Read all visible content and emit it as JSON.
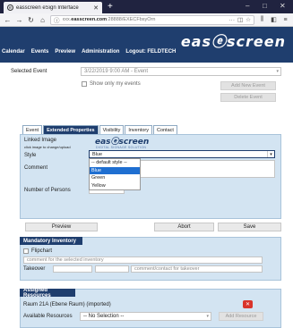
{
  "browser": {
    "tab_title": "easscreen eSign Interface",
    "url_prefix": "xxx.",
    "url_domain": "easscreen.com",
    "url_rest": ":28888/EXECFbsyOrn",
    "url_menu": "···"
  },
  "app": {
    "logo": "easⓔscreen",
    "menu": [
      "Calendar",
      "Events",
      "Preview",
      "Administration",
      "Logout: FELDTECH"
    ]
  },
  "event_select": {
    "label": "Selected Event",
    "value": "3/22/2019 9:00 AM - Event",
    "only_mine_label": "Show only my events",
    "add_btn": "Add New Event",
    "delete_btn": "Delete Event"
  },
  "tabs": [
    "Event",
    "Extended Properties",
    "Visibility",
    "Inventory",
    "Contact"
  ],
  "active_tab": "Extended Properties",
  "props": {
    "linked_image_label": "Linked Image",
    "linked_image_hint": "click image to change/upload",
    "mini_logo": "easⓔscreen",
    "mini_logo_sub": "DIGITAL SIGNAGE SOLUTION",
    "style_label": "Style",
    "style_value": "Blue",
    "style_options": [
      "-- default style --",
      "Blue",
      "Green",
      "Yellow"
    ],
    "comment_label": "Comment",
    "persons_label": "Number of Persons"
  },
  "actions": {
    "preview": "Preview",
    "abort": "Abort",
    "save": "Save"
  },
  "mandatory": {
    "header": "Mandatory Inventory",
    "item": "Flipchart",
    "comment_placeholder": "comment for the selected inventory",
    "takeover_label": "Takeover",
    "takeover_placeholder": "comment/contact for takeover"
  },
  "resources": {
    "header": "Assigned Resources",
    "assigned": "Raum 21A (Ebene Raum) (imported)",
    "available_label": "Available Resources",
    "available_value": "-- No Selection --",
    "add_btn": "Add Resource"
  },
  "colors": {
    "brand": "#1f3e6e",
    "panel": "#d3e4f2",
    "highlight": "#1f6fd1",
    "delete": "#d9342b"
  }
}
